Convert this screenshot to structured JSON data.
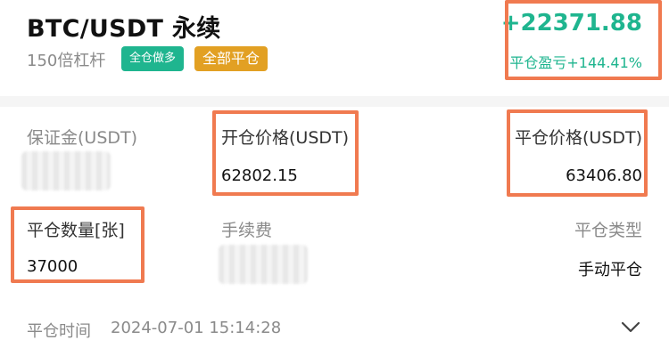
{
  "header": {
    "title": "BTC/USDT 永续",
    "leverage": "150倍杠杆",
    "badge_mode": "全仓做多",
    "badge_close": "全部平仓",
    "pnl": "+22371.88",
    "pnl_pct": "平仓盈亏+144.41%"
  },
  "fields": {
    "margin_label": "保证金(USDT)",
    "open_price_label": "开仓价格(USDT)",
    "open_price_value": "62802.15",
    "close_price_label": "平仓价格(USDT)",
    "close_price_value": "63406.80",
    "close_qty_label": "平仓数量[张]",
    "close_qty_value": "37000",
    "fee_label": "手续费",
    "close_type_label": "平仓类型",
    "close_type_value": "手动平仓"
  },
  "footer": {
    "close_time_label": "平仓时间",
    "close_time_value": "2024-07-01 15:14:28"
  },
  "icons": {
    "expand": "chevron-down-icon"
  },
  "colors": {
    "profit_green": "#1fb58f",
    "badge_orange": "#e2a023",
    "highlight": "#f07a50"
  }
}
